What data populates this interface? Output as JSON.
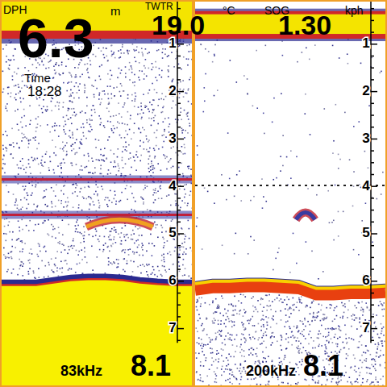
{
  "readings": [
    {
      "label": "DPH",
      "value": "6.3",
      "unit": "m"
    },
    {
      "label": "TWTR",
      "value": "19.0",
      "unit": "°C"
    },
    {
      "label": "SOG",
      "value": "1.30",
      "unit": "kph"
    }
  ],
  "time": {
    "label": "Time",
    "value": "18:28"
  },
  "panels": [
    {
      "frequency": "83kHz",
      "range": "8.1",
      "scale": [
        "1",
        "2",
        "3",
        "4",
        "5",
        "6",
        "7"
      ],
      "surface": [
        0,
        0.85
      ],
      "noise": 0.7,
      "bottom_kind": "solid",
      "bottom": [
        6.1,
        6.1,
        6.1,
        6.05,
        6.0,
        5.98,
        5.98,
        6.0,
        6.05,
        6.08,
        6.1,
        6.1
      ],
      "layers": [
        {
          "depth": 3.85,
          "color": "#c0203a",
          "kind": "solid"
        },
        {
          "depth": 4.6,
          "color": "#c0203a",
          "kind": "solid"
        }
      ],
      "targets": [
        {
          "x": 0.62,
          "depth": 4.75,
          "width": 0.35,
          "color": "#f0a020"
        }
      ]
    },
    {
      "frequency": "200kHz",
      "range": "8.1",
      "scale": [
        "1",
        "2",
        "3",
        "4",
        "5",
        "6",
        "7"
      ],
      "surface": [
        0.25,
        0.8
      ],
      "noise": 0.06,
      "bottom_kind": "band",
      "bottom": [
        6.05,
        6.0,
        6.0,
        5.98,
        5.98,
        6.0,
        6.02,
        6.15,
        6.15,
        6.12,
        6.12,
        6.1
      ],
      "layers": [
        {
          "depth": 3.98,
          "color": "#202020",
          "kind": "dashed"
        }
      ],
      "targets": [
        {
          "x": 0.58,
          "depth": 4.6,
          "width": 0.1,
          "color": "#3a3aa0"
        }
      ]
    }
  ]
}
